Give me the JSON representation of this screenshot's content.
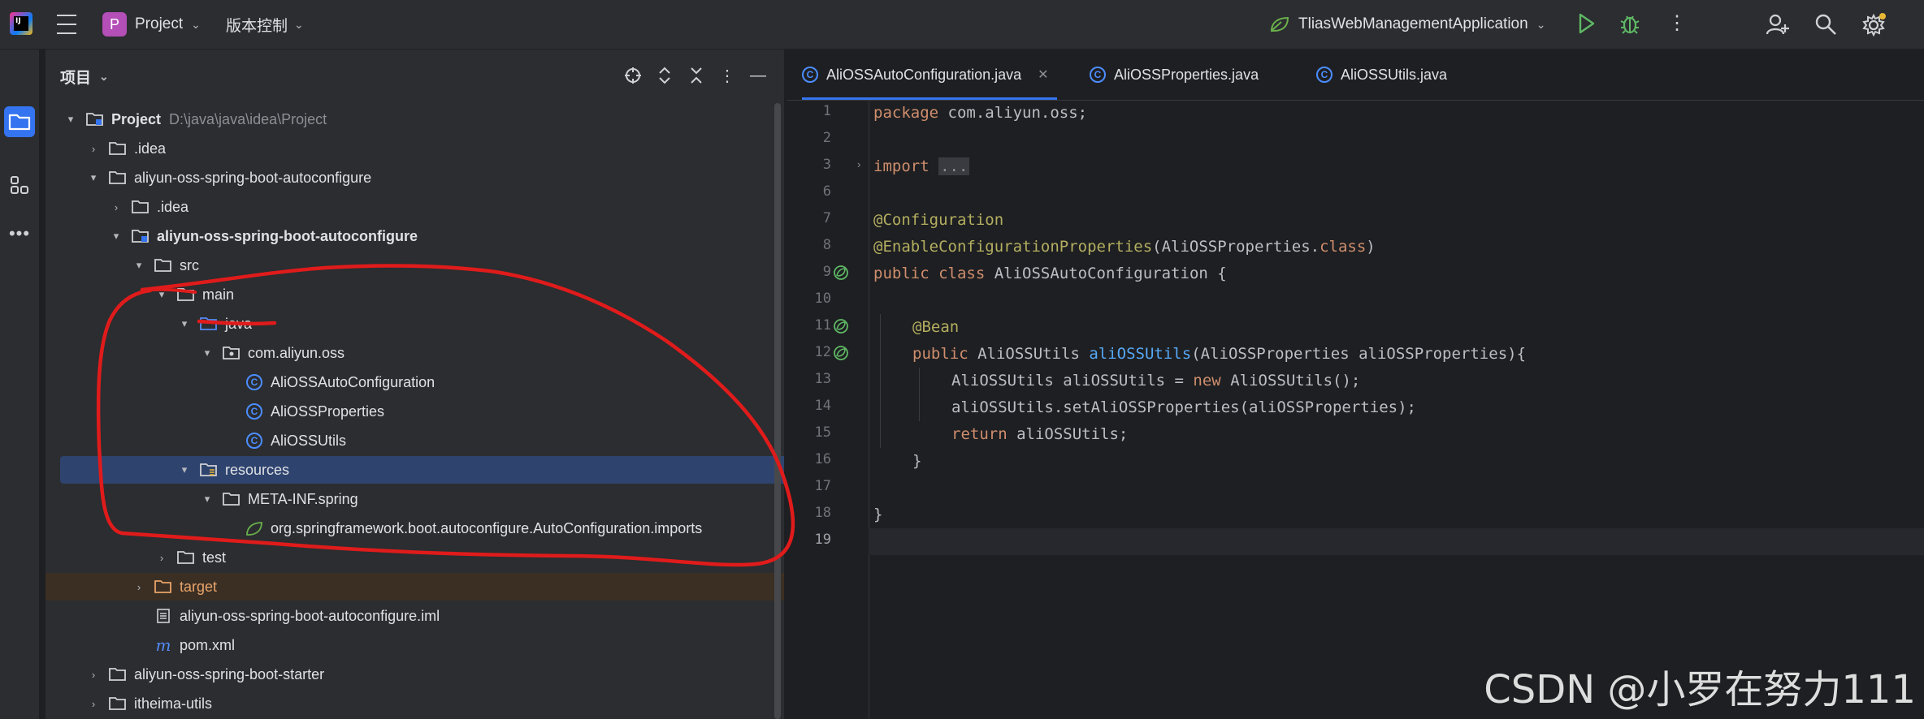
{
  "titlebar": {
    "project_badge": "P",
    "project_name": "Project",
    "vcs_label": "版本控制",
    "run_config": "TliasWebManagementApplication"
  },
  "panel": {
    "title": "项目"
  },
  "tree": [
    {
      "label": "Project",
      "path": "D:\\java\\java\\idea\\Project",
      "bold": true
    },
    {
      "label": ".idea"
    },
    {
      "label": "aliyun-oss-spring-boot-autoconfigure"
    },
    {
      "label": ".idea"
    },
    {
      "label": "aliyun-oss-spring-boot-autoconfigure",
      "bold": true
    },
    {
      "label": "src"
    },
    {
      "label": "main"
    },
    {
      "label": "java"
    },
    {
      "label": "com.aliyun.oss"
    },
    {
      "label": "AliOSSAutoConfiguration"
    },
    {
      "label": "AliOSSProperties"
    },
    {
      "label": "AliOSSUtils"
    },
    {
      "label": "resources"
    },
    {
      "label": "META-INF.spring"
    },
    {
      "label": "org.springframework.boot.autoconfigure.AutoConfiguration.imports"
    },
    {
      "label": "test"
    },
    {
      "label": "target"
    },
    {
      "label": "aliyun-oss-spring-boot-autoconfigure.iml"
    },
    {
      "label": "pom.xml"
    },
    {
      "label": "aliyun-oss-spring-boot-starter"
    },
    {
      "label": "itheima-utils"
    }
  ],
  "tabs": [
    {
      "label": "AliOSSAutoConfiguration.java",
      "active": true
    },
    {
      "label": "AliOSSProperties.java",
      "active": false
    },
    {
      "label": "AliOSSUtils.java",
      "active": false
    }
  ],
  "line_numbers": [
    "1",
    "2",
    "3",
    "6",
    "7",
    "8",
    "9",
    "10",
    "11",
    "12",
    "13",
    "14",
    "15",
    "16",
    "17",
    "18",
    "19"
  ],
  "code": {
    "l1_kw": "package",
    "l1_rest": " com.aliyun.oss;",
    "l3_kw": "import",
    "l3_fold": "...",
    "l7_ann": "@Configuration",
    "l8_ann": "@EnableConfigurationProperties",
    "l8_mid": "(AliOSSProperties.",
    "l8_kw": "class",
    "l8_end": ")",
    "l9_kw": "public class",
    "l9_rest": " AliOSSAutoConfiguration {",
    "l11_ann": "@Bean",
    "l12_kw": "public",
    "l12_a": " AliOSSUtils ",
    "l12_fn": "aliOSSUtils",
    "l12_b": "(AliOSSProperties aliOSSProperties){",
    "l13_a": "AliOSSUtils aliOSSUtils = ",
    "l13_kw": "new",
    "l13_b": " AliOSSUtils();",
    "l14": "aliOSSUtils.setAliOSSProperties(aliOSSProperties);",
    "l15_kw": "return",
    "l15_rest": " aliOSSUtils;",
    "l16": "}",
    "l18": "}"
  },
  "watermark": "CSDN @小罗在努力111",
  "colors": {
    "accent": "#3574f0",
    "annotation_red": "#e01b1b",
    "selection": "#2e436e"
  }
}
